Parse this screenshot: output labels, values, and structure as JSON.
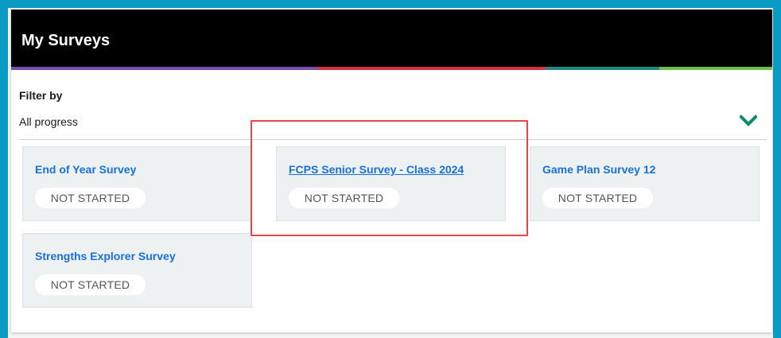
{
  "header": {
    "title": "My Surveys"
  },
  "colorbar": [
    "#7a4fb5",
    "#d6343c",
    "#1d8a7e",
    "#6cbf4a"
  ],
  "filter": {
    "label": "Filter by",
    "value": "All progress"
  },
  "colors": {
    "link": "#1a6fd6",
    "chevron": "#0a8a6a",
    "highlight": "#e0484a"
  },
  "surveys": [
    {
      "title": "End of Year Survey",
      "status": "NOT STARTED"
    },
    {
      "title": "FCPS Senior Survey - Class 2024",
      "status": "NOT STARTED"
    },
    {
      "title": "Game Plan Survey 12",
      "status": "NOT STARTED"
    },
    {
      "title": "Strengths Explorer Survey",
      "status": "NOT STARTED"
    }
  ]
}
